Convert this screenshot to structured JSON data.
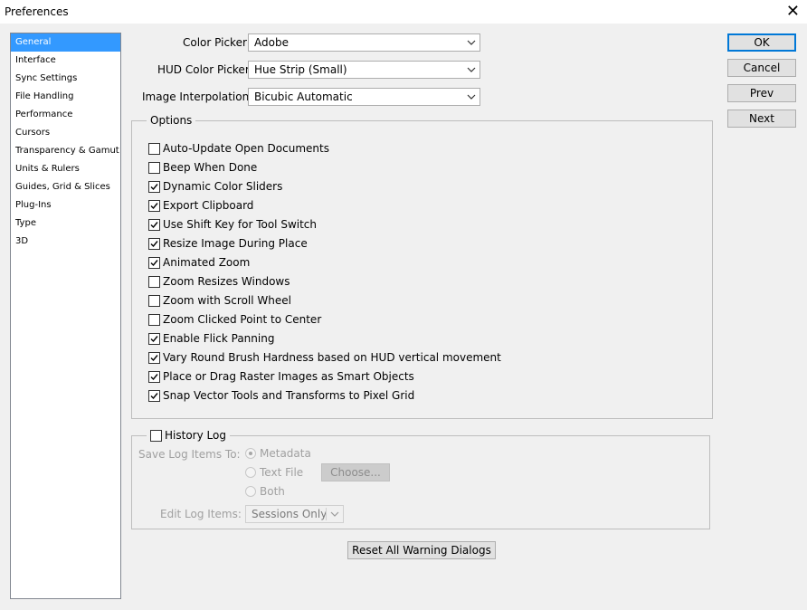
{
  "window": {
    "title": "Preferences",
    "close_glyph": "✕"
  },
  "sidebar": {
    "items": [
      {
        "label": "General",
        "selected": true
      },
      {
        "label": "Interface"
      },
      {
        "label": "Sync Settings"
      },
      {
        "label": "File Handling"
      },
      {
        "label": "Performance"
      },
      {
        "label": "Cursors"
      },
      {
        "label": "Transparency & Gamut"
      },
      {
        "label": "Units & Rulers"
      },
      {
        "label": "Guides, Grid & Slices"
      },
      {
        "label": "Plug-Ins"
      },
      {
        "label": "Type"
      },
      {
        "label": "3D"
      }
    ]
  },
  "fields": {
    "color_picker": {
      "label": "Color Picker:",
      "value": "Adobe"
    },
    "hud_color_picker": {
      "label": "HUD Color Picker:",
      "value": "Hue Strip (Small)"
    },
    "image_interpolation": {
      "label": "Image Interpolation:",
      "value": "Bicubic Automatic"
    }
  },
  "buttons": {
    "ok": "OK",
    "cancel": "Cancel",
    "prev": "Prev",
    "next": "Next",
    "reset_warnings": "Reset All Warning Dialogs"
  },
  "options": {
    "legend": "Options",
    "items": [
      {
        "label": "Auto-Update Open Documents",
        "checked": false
      },
      {
        "label": "Beep When Done",
        "checked": false
      },
      {
        "label": "Dynamic Color Sliders",
        "checked": true
      },
      {
        "label": "Export Clipboard",
        "checked": true
      },
      {
        "label": "Use Shift Key for Tool Switch",
        "checked": true
      },
      {
        "label": "Resize Image During Place",
        "checked": true
      },
      {
        "label": "Animated Zoom",
        "checked": true
      },
      {
        "label": "Zoom Resizes Windows",
        "checked": false
      },
      {
        "label": "Zoom with Scroll Wheel",
        "checked": false
      },
      {
        "label": "Zoom Clicked Point to Center",
        "checked": false
      },
      {
        "label": "Enable Flick Panning",
        "checked": true
      },
      {
        "label": "Vary Round Brush Hardness based on HUD vertical movement",
        "checked": true
      },
      {
        "label": "Place or Drag Raster Images as Smart Objects",
        "checked": true
      },
      {
        "label": "Snap Vector Tools and Transforms to Pixel Grid",
        "checked": true
      }
    ]
  },
  "history_log": {
    "label": "History Log",
    "checked": false,
    "save_to_label": "Save Log Items To:",
    "radios": [
      {
        "label": "Metadata",
        "selected": true
      },
      {
        "label": "Text File",
        "selected": false
      },
      {
        "label": "Both",
        "selected": false
      }
    ],
    "choose_button": "Choose...",
    "edit_label": "Edit Log Items:",
    "edit_value": "Sessions Only"
  }
}
